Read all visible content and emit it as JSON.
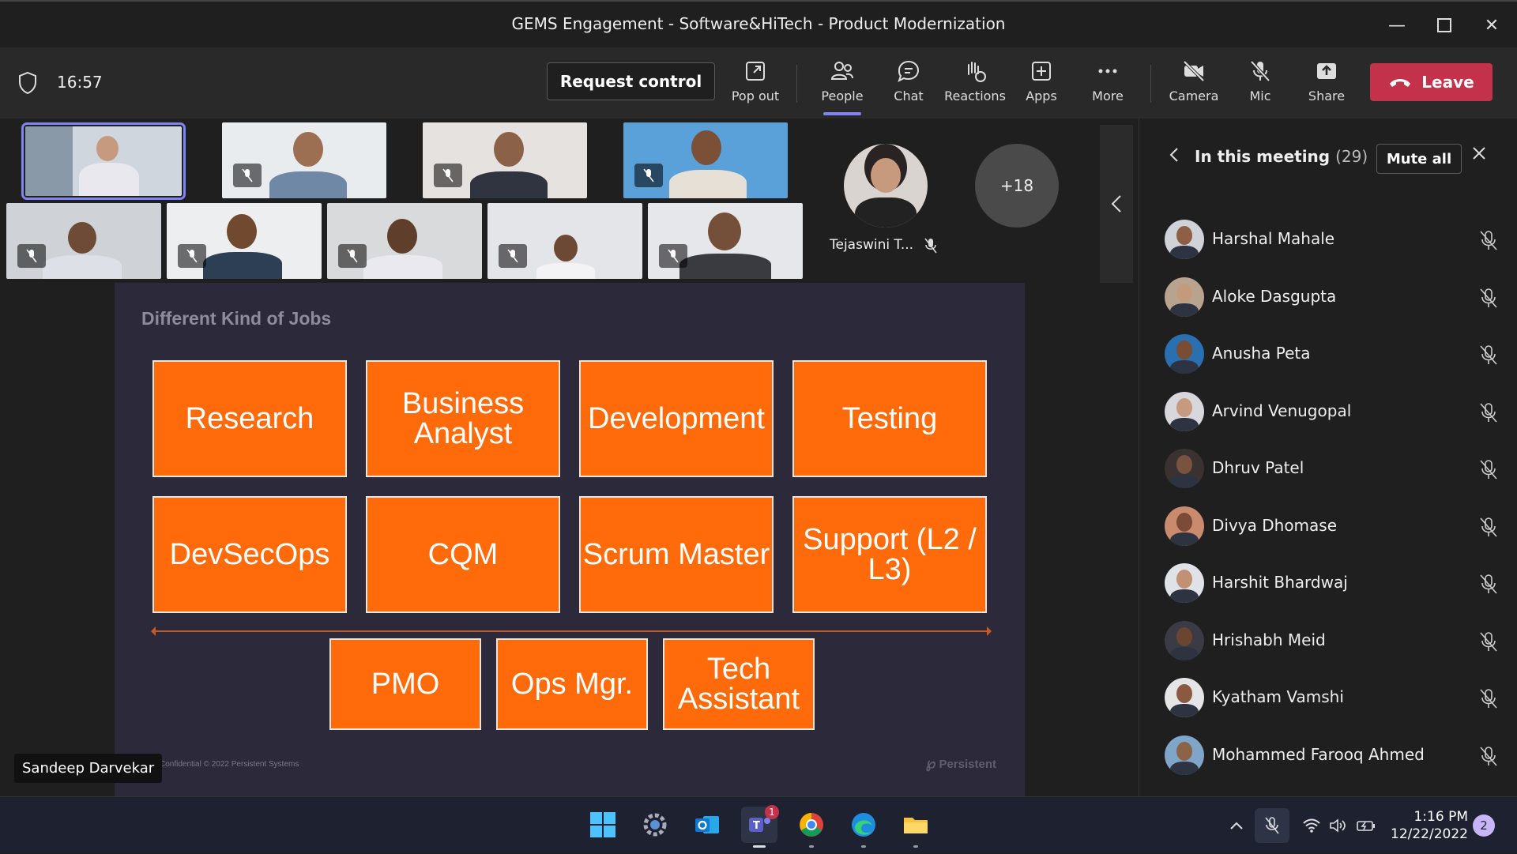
{
  "window": {
    "title": "GEMS Engagement - Software&HiTech - Product Modernization"
  },
  "toolbar": {
    "time": "16:57",
    "request_control": "Request control",
    "pop_out": "Pop out",
    "people": "People",
    "chat": "Chat",
    "reactions": "Reactions",
    "apps": "Apps",
    "more": "More",
    "camera": "Camera",
    "mic": "Mic",
    "share": "Share",
    "leave": "Leave"
  },
  "stage": {
    "featured_name": "Tejaswini T...",
    "overflow_count": "+18",
    "presenter_name": "Sandeep Darvekar"
  },
  "slide": {
    "title": "Different Kind of Jobs",
    "jobs_row1": [
      "Research",
      "Business Analyst",
      "Development",
      "Testing"
    ],
    "jobs_row2": [
      "DevSecOps",
      "CQM",
      "Scrum Master",
      "Support (L2 / L3)"
    ],
    "jobs_row3": [
      "PMO",
      "Ops Mgr.",
      "Tech Assistant"
    ],
    "footer": "Confidential © 2022 Persistent Systems",
    "brand": "Persistent"
  },
  "panel": {
    "title": "In this meeting",
    "count": "(29)",
    "mute_all": "Mute all",
    "participants": [
      "Harshal Mahale",
      "Aloke Dasgupta",
      "Anusha Peta",
      "Arvind Venugopal",
      "Dhruv Patel",
      "Divya Dhomase",
      "Harshit Bhardwaj",
      "Hrishabh Meid",
      "Kyatham Vamshi",
      "Mohammed Farooq Ahmed"
    ]
  },
  "taskbar": {
    "time": "1:16 PM",
    "date": "12/22/2022",
    "teams_badge": "1",
    "notifications": "2"
  }
}
